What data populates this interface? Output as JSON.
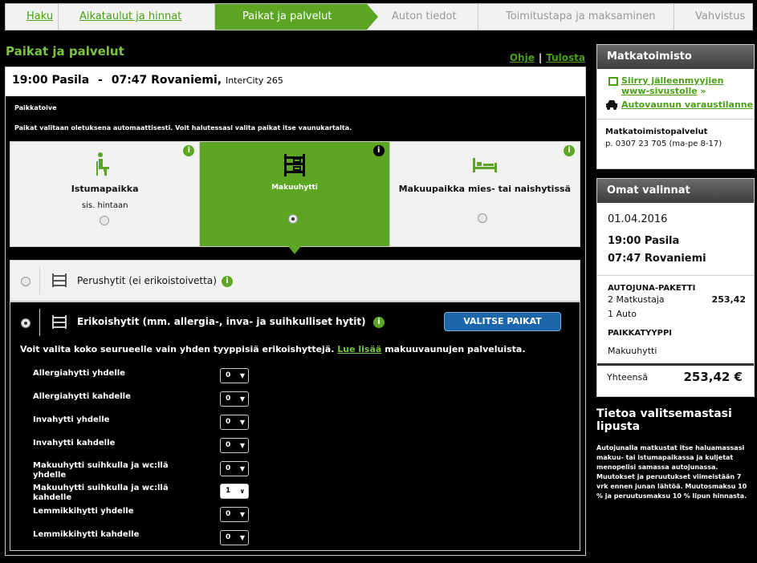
{
  "steps": [
    {
      "label": "Haku",
      "state": "link"
    },
    {
      "label": "Aikataulut ja hinnat",
      "state": "link"
    },
    {
      "label": "Paikat ja palvelut",
      "state": "active"
    },
    {
      "label": "Auton tiedot",
      "state": "todo"
    },
    {
      "label": "Toimitustapa ja maksaminen",
      "state": "todo"
    },
    {
      "label": "Vahvistus",
      "state": "todo"
    }
  ],
  "page_title": "Paikat ja palvelut",
  "help": {
    "ohje": "Ohje",
    "sep": "|",
    "tulosta": "Tulosta"
  },
  "train": {
    "dep": "19:00 Pasila",
    "dash": "-",
    "arr": "07:47 Rovaniemi,",
    "type": "InterCity 265"
  },
  "instr": {
    "line1": "Paikkatoive",
    "line2": "Paikat valitaan oletuksena automaattisesti. Voit halutessasi valita paikat itse vaunukartalta."
  },
  "types": [
    {
      "label": "Istumapaikka",
      "sub": "sis. hintaan",
      "selected": false
    },
    {
      "label": "Makuuhytti",
      "sub": "",
      "selected": true
    },
    {
      "label": "Makuupaikka mies- tai naishytissä",
      "sub": "",
      "selected": false
    }
  ],
  "cabin1": {
    "label": "Perushytit (ei erikoistoivetta)"
  },
  "cabin2": {
    "label": "Erikoishytit (mm. allergia-, inva- ja suihkulliset hytit)",
    "button": "VALITSE PAIKAT",
    "note_a": "Voit valita koko seurueelle vain yhden tyyppisiä erikoishyttejä.",
    "note_link": "Lue lisää",
    "note_b": "makuuvaunujen palveluista."
  },
  "rows": [
    {
      "label": "Allergiahytti yhdelle",
      "value": "0"
    },
    {
      "label": "Allergiahytti kahdelle",
      "value": "0"
    },
    {
      "label": "Invahytti yhdelle",
      "value": "0"
    },
    {
      "label": "Invahytti kahdelle",
      "value": "0"
    },
    {
      "label": "Makuuhytti suihkulla ja wc:llä yhdelle",
      "value": "0"
    },
    {
      "label": "Makuuhytti suihkulla ja wc:llä kahdelle",
      "value": "1"
    },
    {
      "label": "Lemmikkihytti yhdelle",
      "value": "0"
    },
    {
      "label": "Lemmikkihytti kahdelle",
      "value": "0"
    }
  ],
  "agency": {
    "title": "Matkatoimisto",
    "link1": "Siirry jälleenmyyjien www-sivustolle",
    "arrow": "»",
    "link2": "Autovaunun varaustilanne",
    "service_title": "Matkatoimistopalvelut",
    "phone": "p. 0307 23 705 (ma-pe 8-17)"
  },
  "choices": {
    "title": "Omat valinnat",
    "date": "01.04.2016",
    "dep": "19:00 Pasila",
    "arr": "07:47 Rovaniemi",
    "package": "AUTOJUNA-PAKETTI",
    "travellers": "2 Matkustaja",
    "price": "253,42",
    "car": "1 Auto",
    "seat_type_h": "PAIKKATYYPPI",
    "seat_type": "Makuuhytti",
    "total_label": "Yhteensä",
    "total": "253,42 €"
  },
  "ticket": {
    "title": "Tietoa valitsemastasi lipusta",
    "text": "Autojunalla matkustat itse haluamassasi makuu- tai istumapaikassa ja kuljetat menopelisi samassa autojunassa. Muutokset ja peruutukset viimeistään 7 vrk ennen junan lähtöä. Muutosmaksu 10 % ja peruutusmaksu 10 % lipun hinnasta."
  },
  "colors": {
    "green": "#5ca624",
    "light_green": "#7bc43f",
    "blue_button": "#1c66a9"
  }
}
